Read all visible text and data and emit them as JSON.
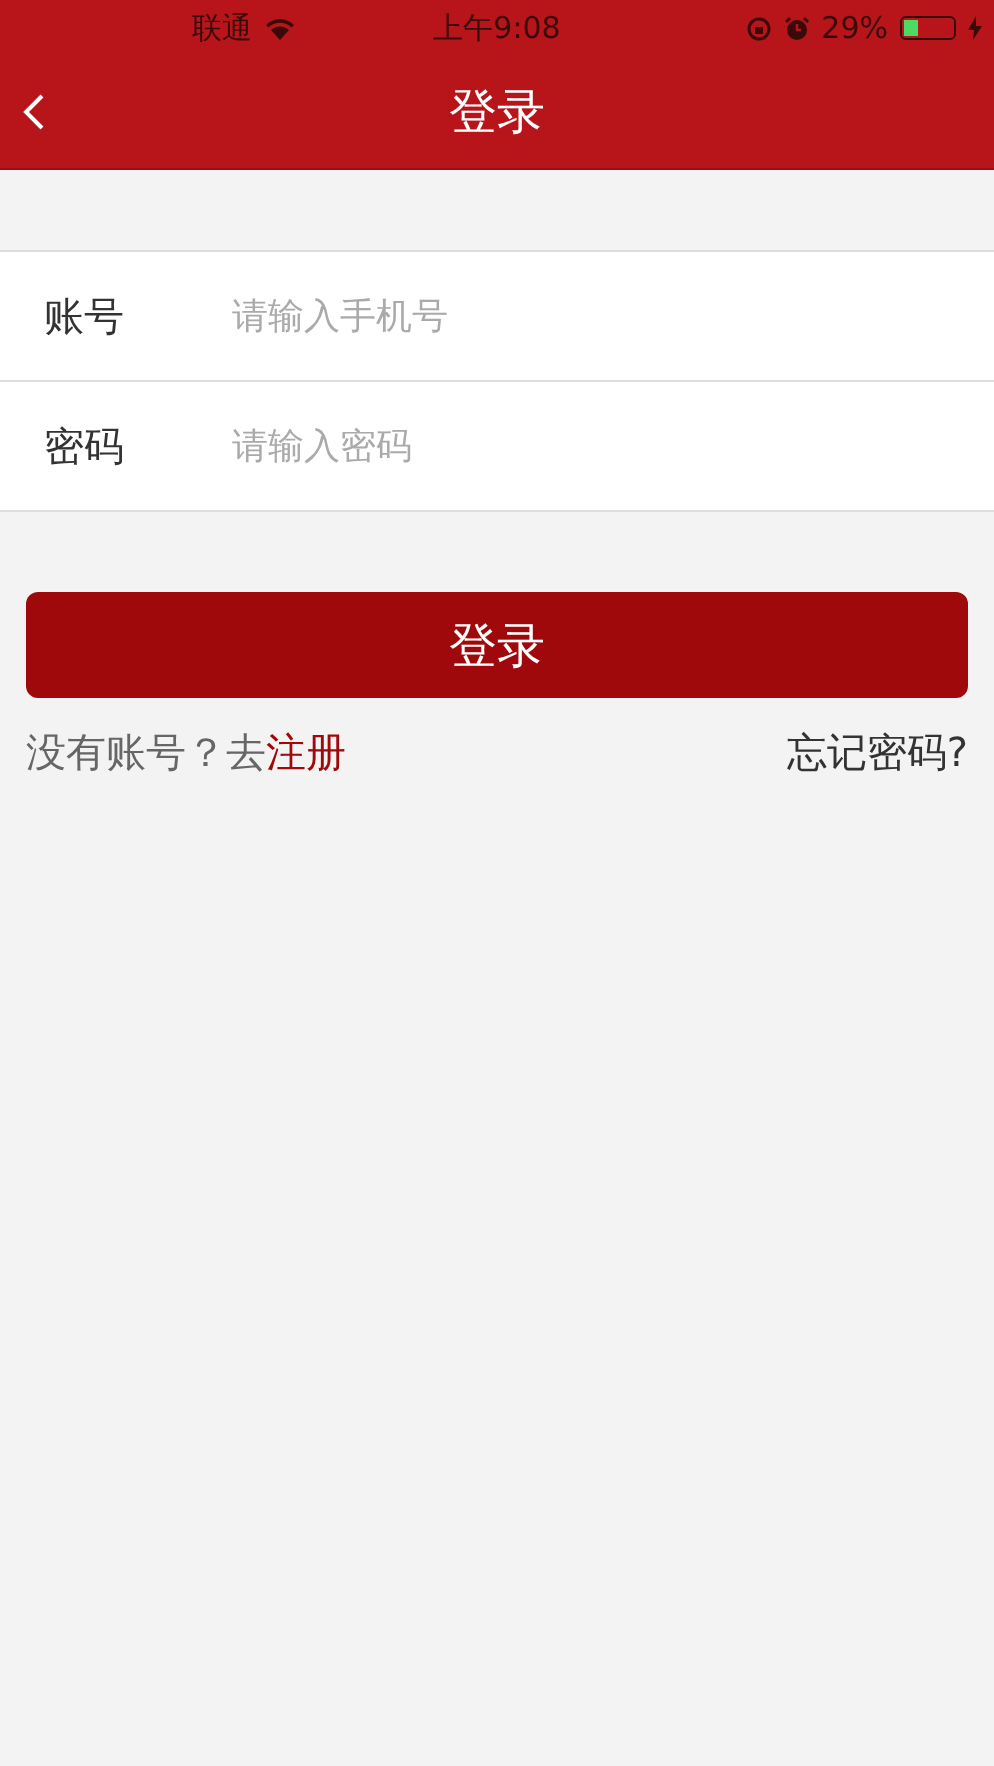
{
  "status_bar": {
    "carrier": "联通",
    "time": "上午9:08",
    "battery_text": "29%",
    "battery": {
      "level": 0.29,
      "charging": true
    }
  },
  "nav": {
    "title": "登录"
  },
  "form": {
    "fields": [
      {
        "label": "账号",
        "placeholder": "请输入手机号"
      },
      {
        "label": "密码",
        "placeholder": "请输入密码"
      }
    ]
  },
  "login_button": "登录",
  "register": {
    "prompt": "没有账号？去",
    "link": "注册"
  },
  "forgot": "忘记密码?"
}
